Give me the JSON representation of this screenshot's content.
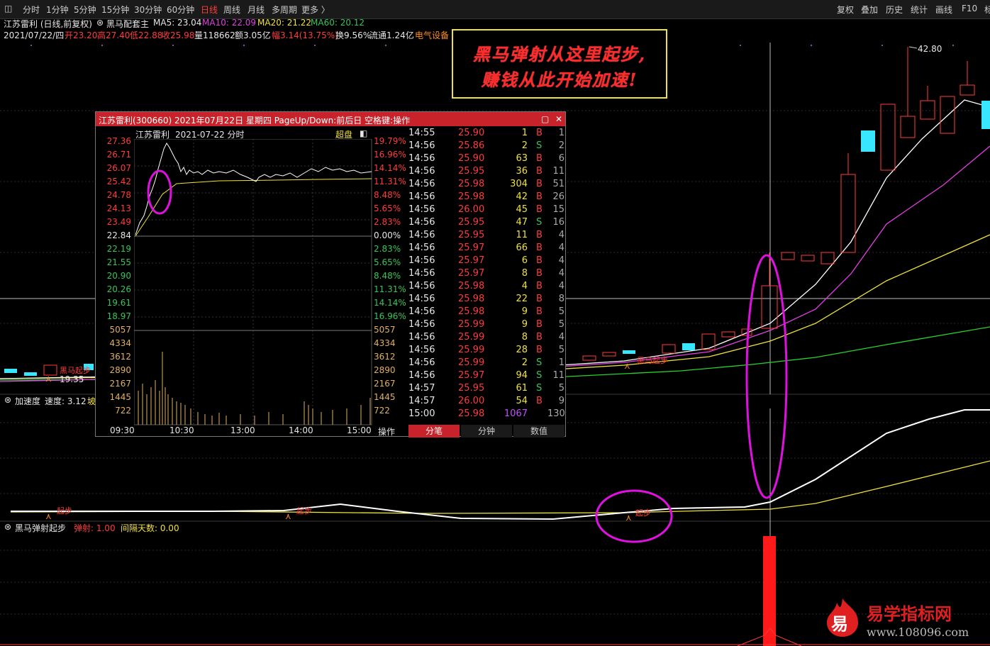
{
  "toolbar": {
    "periods": [
      "分时",
      "1分钟",
      "5分钟",
      "15分钟",
      "30分钟",
      "60分钟",
      "日线",
      "周线",
      "月线",
      "多周期",
      "更多 〉"
    ],
    "active": "日线",
    "right": [
      "复权",
      "叠加",
      "历史",
      "统计",
      "画线",
      "F10",
      "标"
    ]
  },
  "header": {
    "title": "江苏雷利 (日线,前复权)",
    "indicator_name": "黑马配套主",
    "ma5": "MA5: 23.04",
    "ma10": "MA10: 22.09",
    "ma20": "MA20: 21.22",
    "ma60": "MA60: 20.12"
  },
  "info_line": {
    "date": "2021/07/22/四",
    "open": "开23.20",
    "high": "高27.40",
    "low": "低22.88",
    "close": "收25.98",
    "volume": "量118662",
    "amount": "额3.05亿",
    "change": "幅3.14(13.75%)",
    "turnover": "换9.56%",
    "float": "流通1.24亿",
    "sector": "电气设备"
  },
  "callout": {
    "line1": "黑马弹射从这里起步,",
    "line2": "赚钱从此开始加速!"
  },
  "chart": {
    "high_label": "42.80",
    "low_label": "19.35",
    "signal_labels": [
      "黑马起步",
      "黑马起步"
    ]
  },
  "panel2": {
    "name": "加速度",
    "speed": "速度: 3.12",
    "extra": "坡",
    "signal_label": "起步"
  },
  "panel3": {
    "name": "黑马弹射起步",
    "eject": "弹射: 1.00",
    "interval": "间隔天数: 0.00"
  },
  "popup": {
    "title": "江苏雷利(300660) 2021年07月22日 星期四 PageUp/Down:前后日 空格键:操作",
    "sub_name": "江苏雷利",
    "sub_date": "2021-07-22 分时",
    "sub_right": "超盘",
    "price_labels": [
      "27.36",
      "26.71",
      "26.07",
      "25.42",
      "24.78",
      "24.13",
      "23.49",
      "22.84",
      "22.19",
      "21.55",
      "20.90",
      "20.26",
      "19.61",
      "18.97"
    ],
    "pct_labels": [
      "19.79%",
      "16.96%",
      "14.14%",
      "11.31%",
      "8.48%",
      "5.65%",
      "2.83%",
      "0.00%",
      "2.83%",
      "5.65%",
      "8.48%",
      "11.31%",
      "14.14%",
      "16.96%"
    ],
    "vol_labels": [
      "5057",
      "4334",
      "3612",
      "2890",
      "2167",
      "1445",
      "722"
    ],
    "time_labels": [
      "09:30",
      "10:30",
      "13:00",
      "14:00",
      "15:00"
    ],
    "op_label": "操作",
    "tabs": [
      "分笔",
      "分钟",
      "数值"
    ],
    "trades": [
      [
        "14:55",
        "25.90",
        "1",
        "B",
        "1"
      ],
      [
        "14:56",
        "25.86",
        "2",
        "S",
        "2"
      ],
      [
        "14:56",
        "25.90",
        "63",
        "B",
        "6"
      ],
      [
        "14:56",
        "25.95",
        "36",
        "B",
        "11"
      ],
      [
        "14:56",
        "25.98",
        "304",
        "B",
        "51"
      ],
      [
        "14:56",
        "25.98",
        "42",
        "B",
        "26"
      ],
      [
        "14:56",
        "26.00",
        "45",
        "B",
        "15"
      ],
      [
        "14:56",
        "25.95",
        "47",
        "S",
        "16"
      ],
      [
        "14:56",
        "25.95",
        "11",
        "B",
        "4"
      ],
      [
        "14:56",
        "25.97",
        "66",
        "B",
        "4"
      ],
      [
        "14:56",
        "25.97",
        "6",
        "B",
        "4"
      ],
      [
        "14:56",
        "25.97",
        "8",
        "B",
        "4"
      ],
      [
        "14:56",
        "25.98",
        "4",
        "B",
        "4"
      ],
      [
        "14:56",
        "25.98",
        "22",
        "B",
        "8"
      ],
      [
        "14:56",
        "25.98",
        "9",
        "B",
        "5"
      ],
      [
        "14:56",
        "25.99",
        "9",
        "B",
        "5"
      ],
      [
        "14:56",
        "25.99",
        "8",
        "B",
        "4"
      ],
      [
        "14:56",
        "25.99",
        "28",
        "B",
        "5"
      ],
      [
        "14:56",
        "25.99",
        "2",
        "S",
        "1"
      ],
      [
        "14:56",
        "25.97",
        "94",
        "S",
        "11"
      ],
      [
        "14:57",
        "25.95",
        "61",
        "S",
        "5"
      ],
      [
        "14:57",
        "26.00",
        "54",
        "B",
        "9"
      ],
      [
        "15:00",
        "25.98",
        "1067",
        "",
        "130"
      ]
    ]
  },
  "watermark": {
    "badge": "易",
    "title": "易学指标网",
    "url": "www.108096.com"
  },
  "colors": {
    "up": "#ff3b3b",
    "down": "#39c45a",
    "cyan": "#39e6ff",
    "accent": "#c8222a"
  }
}
